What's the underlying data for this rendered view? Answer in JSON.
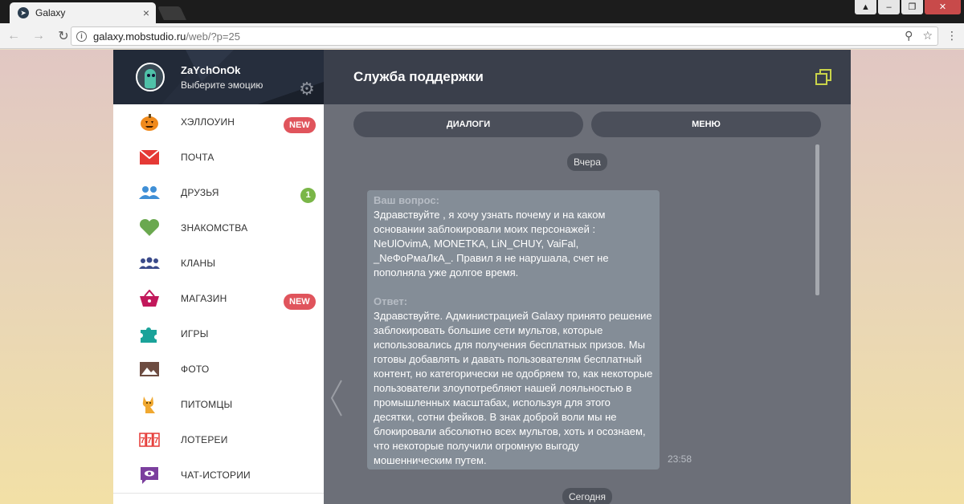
{
  "browser": {
    "tab_title": "Galaxy",
    "url_host": "galaxy.mobstudio.ru",
    "url_path": "/web/?p=25"
  },
  "profile": {
    "nickname": "ZaYchOnOk",
    "status": "Выберите эмоцию"
  },
  "menu": [
    {
      "label": "ХЭЛЛОУИН",
      "icon": "pumpkin-icon",
      "badge": "NEW"
    },
    {
      "label": "ПОЧТА",
      "icon": "mail-icon"
    },
    {
      "label": "ДРУЗЬЯ",
      "icon": "friends-icon",
      "count": "1"
    },
    {
      "label": "ЗНАКОМСТВА",
      "icon": "heart-icon"
    },
    {
      "label": "КЛАНЫ",
      "icon": "clans-icon"
    },
    {
      "label": "МАГАЗИН",
      "icon": "basket-icon",
      "badge": "NEW"
    },
    {
      "label": "ИГРЫ",
      "icon": "puzzle-icon"
    },
    {
      "label": "ФОТО",
      "icon": "photo-icon"
    },
    {
      "label": "ПИТОМЦЫ",
      "icon": "pet-icon"
    },
    {
      "label": "ЛОТЕРЕИ",
      "icon": "lottery-icon"
    },
    {
      "label": "ЧАТ-ИСТОРИИ",
      "icon": "chat-story-icon"
    }
  ],
  "chat": {
    "title": "Служба поддержки",
    "tab_dialogs": "ДИАЛОГИ",
    "tab_menu": "МЕНЮ",
    "date_yesterday": "Вчера",
    "date_today": "Сегодня",
    "message": {
      "question_label": "Ваш вопрос:",
      "question_text": "Здравствуйте , я хочу узнать почему и на каком основании заблокировали моих персонажей : NeUlOvimA, MONETKA, LiN_CHUY, VaiFal, _NeФоРмаЛкА_. Правил я не нарушала, счет не пополняла уже долгое время.",
      "answer_label": "Ответ:",
      "answer_text": "Здравствуйте. Администрацией Galaxy принято решение заблокировать большие сети мультов, которые использовались для получения бесплатных призов. Мы готовы добавлять и давать пользователям бесплатный контент, но категорически не одобряем то, как некоторые пользователи злоупотребляют нашей лояльностью в промышленных масштабах, используя для этого десятки, сотни фейков. В знак доброй воли мы не блокировали абсолютно всех мультов, хоть и осознаем, что некоторые получили огромную выгоду мошенническим путем.",
      "time": "23:58"
    }
  },
  "colors": {
    "header_bg": "#3a3f4b",
    "chat_bg": "#6c6f78",
    "bubble_bg": "#848d97",
    "badge_new": "#e0545c",
    "badge_count": "#7ab648",
    "accent_icon": "#c9d34a"
  }
}
